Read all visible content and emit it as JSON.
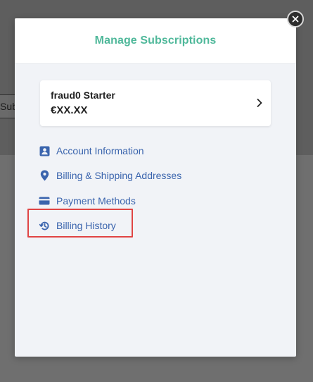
{
  "background": {
    "button_text": "Sub"
  },
  "modal": {
    "title": "Manage Subscriptions",
    "plan": {
      "name": "fraud0 Starter",
      "price": "€XX.XX"
    },
    "menu": [
      {
        "label": "Account Information",
        "icon": "account-card-icon"
      },
      {
        "label": "Billing & Shipping Addresses",
        "icon": "location-pin-icon"
      },
      {
        "label": "Payment Methods",
        "icon": "credit-card-icon"
      },
      {
        "label": "Billing History",
        "icon": "history-icon"
      }
    ]
  },
  "colors": {
    "accent_title": "#4fb89a",
    "link": "#3a64ad",
    "highlight": "#e04444",
    "modal_body": "#f1f3f7"
  }
}
